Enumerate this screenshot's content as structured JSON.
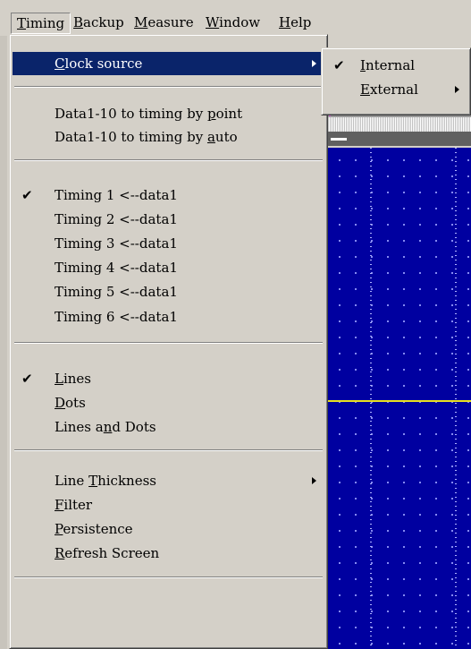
{
  "menubar": {
    "items": [
      {
        "label": "Timing",
        "mnemonic_index": 0
      },
      {
        "label": "Backup",
        "mnemonic_index": 0
      },
      {
        "label": "Measure",
        "mnemonic_index": 0
      },
      {
        "label": "Window",
        "mnemonic_index": 0
      },
      {
        "label": "Help",
        "mnemonic_index": 0
      }
    ]
  },
  "timing_menu": {
    "clock_source": "Clock source",
    "data_by_point": "Data1-10 to timing by point",
    "data_by_auto": "Data1-10 to timing by auto",
    "timings": [
      {
        "label": "Timing 1 <--data1",
        "checked": true
      },
      {
        "label": "Timing 2 <--data1",
        "checked": false
      },
      {
        "label": "Timing 3 <--data1",
        "checked": false
      },
      {
        "label": "Timing 4 <--data1",
        "checked": false
      },
      {
        "label": "Timing 5 <--data1",
        "checked": false
      },
      {
        "label": "Timing 6 <--data1",
        "checked": false
      }
    ],
    "lines": "Lines",
    "dots": "Dots",
    "lines_and_dots": "Lines and Dots",
    "line_thickness": "Line Thickness",
    "filter": "Filter",
    "persistence": "Persistence",
    "refresh_screen": "Refresh Screen"
  },
  "clock_submenu": {
    "internal": "Internal",
    "external": "External"
  },
  "check_glyph": "✔",
  "colors": {
    "highlight": "#0a246a",
    "plot_background": "#0000a0",
    "signal_line": "#e8e020"
  }
}
